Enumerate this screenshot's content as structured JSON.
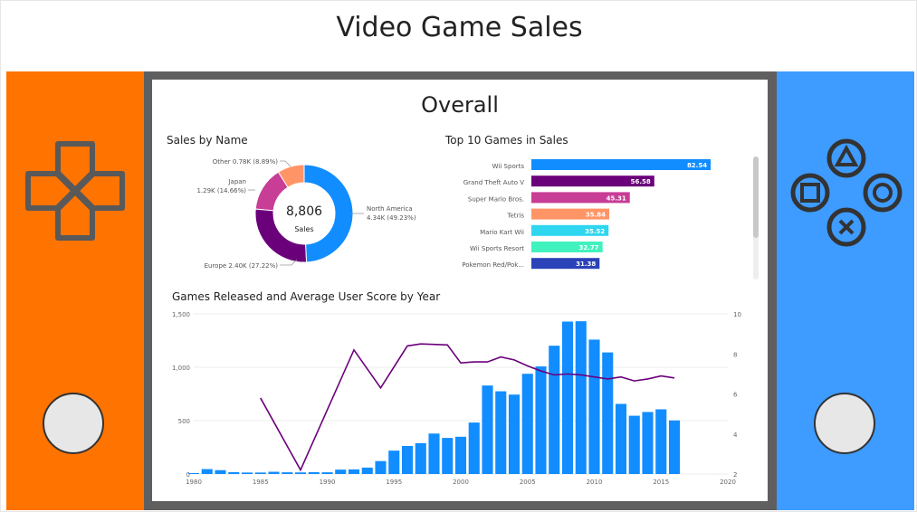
{
  "app": {
    "title": "Video Game Sales"
  },
  "screen": {
    "title": "Overall"
  },
  "colors": {
    "left_panel": "#ff7300",
    "right_panel": "#3e9bff",
    "frame": "#5f5f5f",
    "bar_blue": "#118dff",
    "line_purple": "#6b007b"
  },
  "icons": {
    "left": "dpad-icon",
    "right": "playstation-buttons-icon"
  },
  "donut": {
    "title": "Sales by Name",
    "center_value": "8,806",
    "center_label": "Sales",
    "slices": [
      {
        "name": "North America",
        "value": 4.34,
        "pct": 49.23,
        "color": "#118dff",
        "label_line1": "North America",
        "label_line2": "4.34K (49.23%)"
      },
      {
        "name": "Europe",
        "value": 2.4,
        "pct": 27.22,
        "color": "#6b007b",
        "label_line1": "Europe 2.40K (27.22%)",
        "label_line2": ""
      },
      {
        "name": "Japan",
        "value": 1.29,
        "pct": 14.66,
        "color": "#c83d95",
        "label_line1": "Japan",
        "label_line2": "1.29K (14.66%)"
      },
      {
        "name": "Other",
        "value": 0.78,
        "pct": 8.89,
        "color": "#ff9566",
        "label_line1": "Other 0.78K (8.89%)",
        "label_line2": ""
      }
    ]
  },
  "top10": {
    "title": "Top 10 Games in Sales",
    "xmax": 100,
    "items": [
      {
        "name": "Wii Sports",
        "value": 82.54,
        "label": "82.54",
        "color": "#118dff"
      },
      {
        "name": "Grand Theft Auto V",
        "value": 56.58,
        "label": "56.58",
        "color": "#6b007b"
      },
      {
        "name": "Super Mario Bros.",
        "value": 45.31,
        "label": "45.31",
        "color": "#c83d95"
      },
      {
        "name": "Tetris",
        "value": 35.84,
        "label": "35.84",
        "color": "#ff9566"
      },
      {
        "name": "Mario Kart Wii",
        "value": 35.52,
        "label": "35.52",
        "color": "#2ed6ef"
      },
      {
        "name": "Wii Sports Resort",
        "value": 32.77,
        "label": "32.77",
        "color": "#41f2be"
      },
      {
        "name": "Pokemon Red/Pok...",
        "value": 31.38,
        "label": "31.38",
        "color": "#2b42b8"
      }
    ]
  },
  "chart_data": {
    "type": "bar",
    "title": "Games Released and Average User Score by Year",
    "x": [
      1980,
      1981,
      1982,
      1983,
      1984,
      1985,
      1986,
      1987,
      1988,
      1989,
      1990,
      1991,
      1992,
      1993,
      1994,
      1995,
      1996,
      1997,
      1998,
      1999,
      2000,
      2001,
      2002,
      2003,
      2004,
      2005,
      2006,
      2007,
      2008,
      2009,
      2010,
      2011,
      2012,
      2013,
      2014,
      2015,
      2016
    ],
    "series": [
      {
        "kind": "bar",
        "axis": "left",
        "color": "#118dff",
        "values": [
          9,
          46,
          36,
          17,
          14,
          14,
          21,
          16,
          15,
          17,
          16,
          41,
          43,
          60,
          121,
          219,
          263,
          289,
          379,
          338,
          349,
          482,
          829,
          775,
          744,
          939,
          1008,
          1202,
          1428,
          1431,
          1259,
          1139,
          657,
          546,
          581,
          606,
          502
        ]
      },
      {
        "kind": "line",
        "axis": "right",
        "color": "#6b007b",
        "x": [
          1985,
          1988,
          1992,
          1994,
          1996,
          1997,
          1999,
          2000,
          2001,
          2002,
          2003,
          2004,
          2005,
          2006,
          2007,
          2008,
          2009,
          2010,
          2011,
          2012,
          2013,
          2014,
          2015,
          2016
        ],
        "values": [
          5.8,
          2.2,
          8.2,
          6.3,
          8.4,
          8.5,
          8.45,
          7.55,
          7.6,
          7.6,
          7.85,
          7.7,
          7.4,
          7.15,
          6.95,
          7.0,
          6.95,
          6.85,
          6.75,
          6.85,
          6.65,
          6.75,
          6.9,
          6.8
        ]
      }
    ],
    "ylim": [
      0,
      1500
    ],
    "y2lim": [
      2,
      10
    ],
    "xlim": [
      1980,
      2020
    ],
    "yticks": [
      "0",
      "500",
      "1,000",
      "1,500"
    ],
    "y2ticks": [
      "2",
      "4",
      "6",
      "8",
      "10"
    ],
    "xticks": [
      "1980",
      "1985",
      "1990",
      "1995",
      "2000",
      "2005",
      "2010",
      "2015",
      "2020"
    ]
  }
}
